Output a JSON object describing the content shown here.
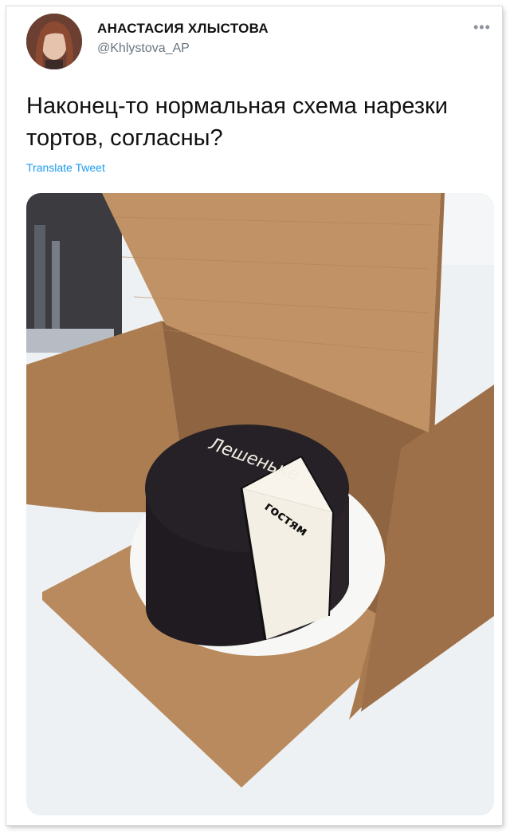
{
  "tweet": {
    "author_name": "АНАСТАСИЯ ХЛЫСТОВА",
    "author_handle": "@Khlystova_AP",
    "more_icon": "•••",
    "text": "Наконец-то нормальная схема нарезки тортов, согласны?",
    "translate_label": "Translate Tweet"
  },
  "photo": {
    "cake_top_text": "Лешенькe",
    "slice_text": "гостям"
  },
  "colors": {
    "link": "#1d9bf0",
    "handle": "#697680",
    "cardboard": "#b98a5e",
    "cake": "#1f1b20",
    "cream": "#f4efe4"
  }
}
